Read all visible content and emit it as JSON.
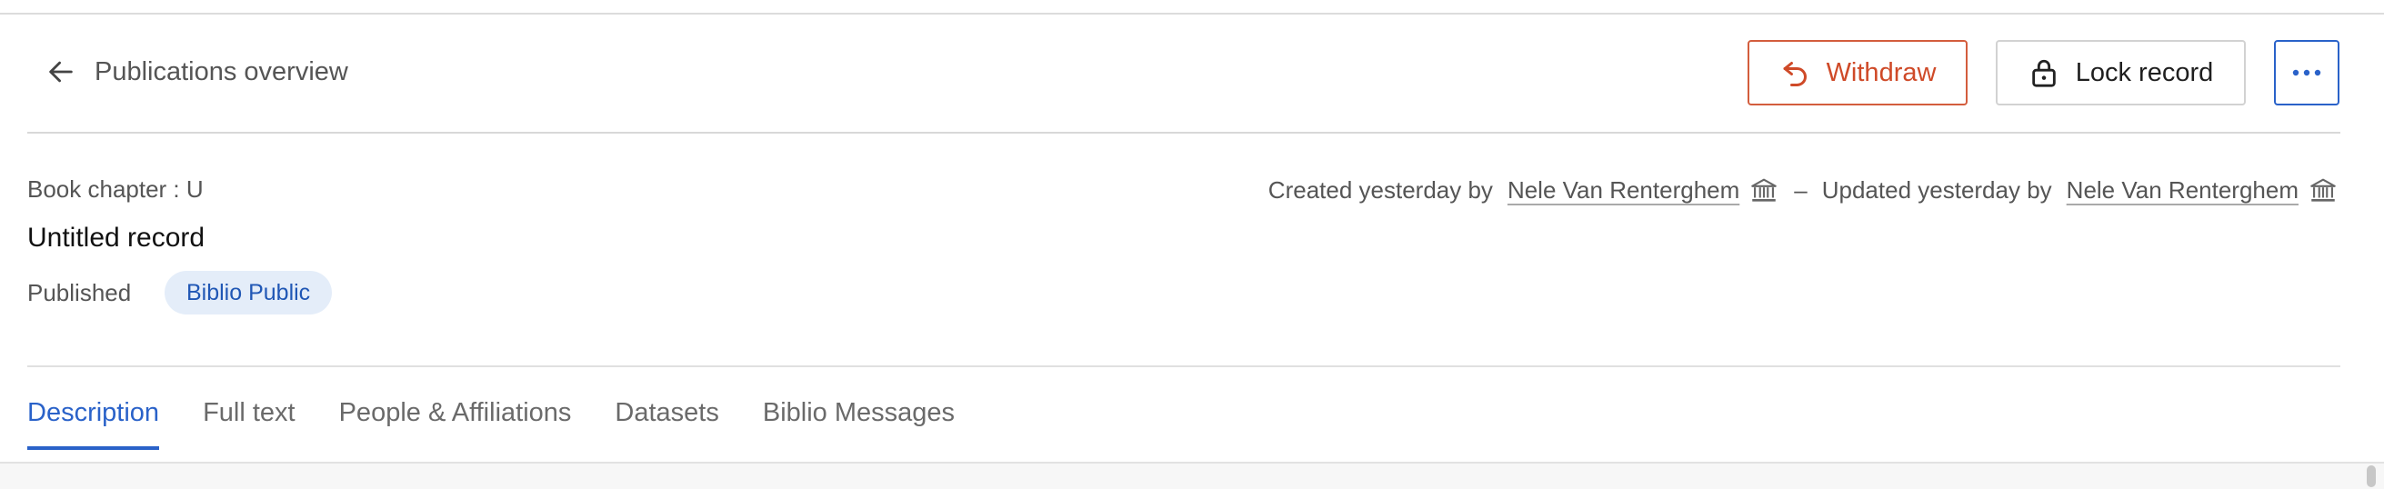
{
  "header": {
    "back_label": "Publications overview",
    "withdraw_label": "Withdraw",
    "lock_label": "Lock record",
    "more_icon": "ellipsis-icon"
  },
  "record": {
    "type": "Book chapter : U",
    "title": "Untitled record",
    "status": "Published",
    "badge": "Biblio Public"
  },
  "meta": {
    "created_prefix": "Created yesterday by",
    "created_by": "Nele Van Renterghem",
    "separator": "–",
    "updated_prefix": "Updated yesterday by",
    "updated_by": "Nele Van Renterghem"
  },
  "tabs": [
    "Description",
    "Full text",
    "People & Affiliations",
    "Datasets",
    "Biblio Messages"
  ],
  "active_tab": "Description",
  "colors": {
    "accent": "#2a62c9",
    "danger": "#cf4a28",
    "badge_bg": "#e4edf9"
  }
}
